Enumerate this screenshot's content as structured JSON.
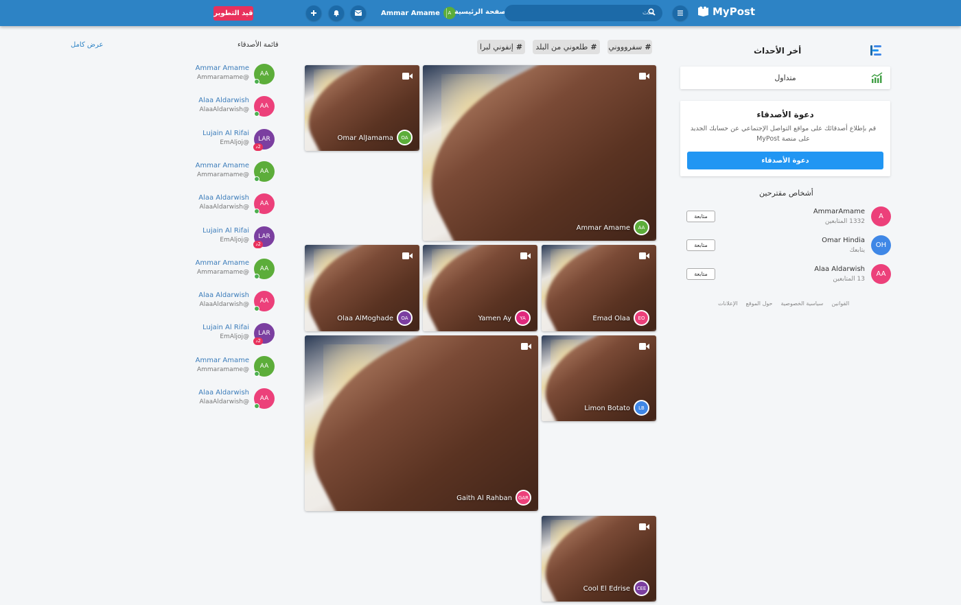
{
  "topbar": {
    "brand": "MyPost",
    "search_placeholder": "بحث",
    "home_link": "الصفحة الرئيسية",
    "user_name": "Ammar Amame",
    "user_initial": "A",
    "dev_badge": "قيد التطوير"
  },
  "sidebar": {
    "events_title": "أخر الأحداث",
    "trending_label": "متداول",
    "invite_title": "دعوة الأصدقاء",
    "invite_text": "قم بإطلاع أصدقائك على مواقع التواصل الإجتماعي عن حسابك الجديد على منصة MyPost",
    "invite_button": "دعوة الأصدقاء",
    "suggested_title": "أشخاص مقترحين",
    "suggested": [
      {
        "name": "AmmarAmame",
        "sub": "1332 المتابعين",
        "initials": "A",
        "color": "#ec407a",
        "button": "متابعة"
      },
      {
        "name": "Omar Hindia",
        "sub": "يتابعك",
        "initials": "OH",
        "color": "#3f87e6",
        "button": "متابعة"
      },
      {
        "name": "Alaa Aldarwish",
        "sub": "13 المتابعين",
        "initials": "AA",
        "color": "#ec407a",
        "button": "متابعة"
      }
    ],
    "footer_links": [
      "القوانين",
      "سياسية الخصوصية",
      "حول الموقع",
      "الإعلانات"
    ]
  },
  "tags": [
    "سفروووني",
    "طلعوني من البلد",
    "إنفوني لبرا"
  ],
  "tiles": [
    {
      "name": "Omar AlJamama",
      "initials": "OA",
      "color": "#5cad3a"
    },
    {
      "name": "Ammar Amame",
      "initials": "AA",
      "color": "#5cad3a"
    },
    {
      "name": "Olaa AlMoghade",
      "initials": "OA",
      "color": "#7b3fa0"
    },
    {
      "name": "Yamen Ay",
      "initials": "YA",
      "color": "#e0287d"
    },
    {
      "name": "Emad Olaa",
      "initials": "EO",
      "color": "#ec407a"
    },
    {
      "name": "Gaith Al Rahban",
      "initials": "GAR",
      "color": "#ec407a"
    },
    {
      "name": "Limon Botato",
      "initials": "LB",
      "color": "#3f87e6"
    },
    {
      "name": "Cool El Edrise",
      "initials": "CEE",
      "color": "#7b3fa0"
    }
  ],
  "friends": {
    "title": "قائمة الأصدقاء",
    "view_all": "عرض كامل",
    "items": [
      {
        "name": "Ammar Amame",
        "user": "Ammaramame@",
        "initials": "AA",
        "color": "#5cad3a",
        "status": "online"
      },
      {
        "name": "Alaa Aldarwish",
        "user": "AlaaAldarwish@",
        "initials": "AA",
        "color": "#ec407a",
        "status": "online"
      },
      {
        "name": "Lujain Al Rifai",
        "user": "EmAljoj@",
        "initials": "LAR",
        "color": "#7b3fa0",
        "status": "2د"
      },
      {
        "name": "Ammar Amame",
        "user": "Ammaramame@",
        "initials": "AA",
        "color": "#5cad3a",
        "status": "online"
      },
      {
        "name": "Alaa Aldarwish",
        "user": "AlaaAldarwish@",
        "initials": "AA",
        "color": "#ec407a",
        "status": "online"
      },
      {
        "name": "Lujain Al Rifai",
        "user": "EmAljoj@",
        "initials": "LAR",
        "color": "#7b3fa0",
        "status": "2د"
      },
      {
        "name": "Ammar Amame",
        "user": "Ammaramame@",
        "initials": "AA",
        "color": "#5cad3a",
        "status": "online"
      },
      {
        "name": "Alaa Aldarwish",
        "user": "AlaaAldarwish@",
        "initials": "AA",
        "color": "#ec407a",
        "status": "online"
      },
      {
        "name": "Lujain Al Rifai",
        "user": "EmAljoj@",
        "initials": "LAR",
        "color": "#7b3fa0",
        "status": "2د"
      },
      {
        "name": "Ammar Amame",
        "user": "Ammaramame@",
        "initials": "AA",
        "color": "#5cad3a",
        "status": "online"
      },
      {
        "name": "Alaa Aldarwish",
        "user": "AlaaAldarwish@",
        "initials": "AA",
        "color": "#ec407a",
        "status": "online"
      }
    ]
  }
}
